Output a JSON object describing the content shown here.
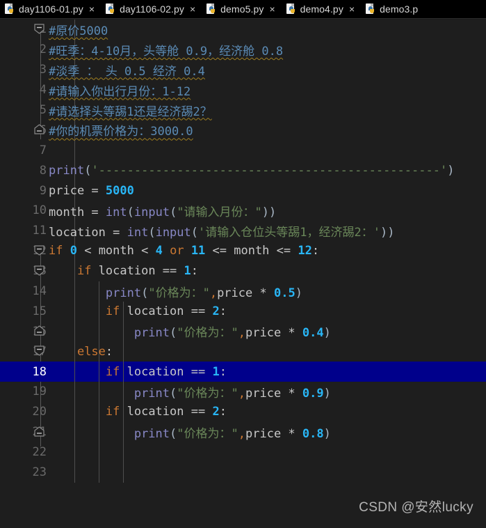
{
  "window": {
    "app": "PyCharm Editor",
    "background": "#1e1e1e"
  },
  "tabbar": {
    "background": "#000000",
    "tabs": [
      {
        "label": "day1106-01.py",
        "close": "×",
        "icon": "python-file-icon",
        "active": true
      },
      {
        "label": "day1106-02.py",
        "close": "×",
        "icon": "python-file-icon",
        "active": false
      },
      {
        "label": "demo5.py",
        "close": "×",
        "icon": "python-file-icon",
        "active": false
      },
      {
        "label": "demo4.py",
        "close": "×",
        "icon": "python-file-icon",
        "active": false
      },
      {
        "label": "demo3.p",
        "close": "",
        "icon": "python-file-icon",
        "active": false
      }
    ]
  },
  "editor": {
    "active_line": 18,
    "highlight_color": "#00008b",
    "gutter_color": "#6a6a6a",
    "colors": {
      "comment": "#5b8bb5",
      "keyword": "#cc7832",
      "number": "#29b6f6",
      "string": "#6a8759",
      "builtin": "#8888c6",
      "identifier": "#c8c8c8",
      "squiggle": "#a08020"
    },
    "line_numbers": [
      "1",
      "2",
      "3",
      "4",
      "5",
      "6",
      "7",
      "8",
      "9",
      "10",
      "11",
      "12",
      "13",
      "14",
      "15",
      "16",
      "17",
      "18",
      "19",
      "20",
      "21",
      "22",
      "23"
    ],
    "lines": {
      "l1": "#原价5000",
      "l2": "#旺季：4-10月，头等舱 0.9，经济舱 0.8",
      "l3": "#淡季 ： 头 0.5 经济 0.4",
      "l4": "#请输入你出行月份：1-12",
      "l5": "#请选择头等舓1还是经济舓2？",
      "l6": "#你的机票价格为：3000.0",
      "l7": "",
      "l8_fn": "print",
      "l8_str": "'------------------------------------------------'",
      "l9_name": "price",
      "l9_eq": " = ",
      "l9_num": "5000",
      "l10_name": "month",
      "l10_eq": " = ",
      "l10_int": "int",
      "l10_input": "input",
      "l10_str": "\"请输入月份：\"",
      "l11_name": "location",
      "l11_eq": " = ",
      "l11_int": "int",
      "l11_input": "input",
      "l11_str": "'请输入仓位头等舓1，经济舓2：'",
      "l12_if": "if",
      "l12_a": "0",
      "l12_op1": " < month < ",
      "l12_b": "4",
      "l12_or": "or",
      "l12_c": "11",
      "l12_op2": " <= month <= ",
      "l12_d": "12",
      "l13_if": "if",
      "l13_name": " location == ",
      "l13_num": "1",
      "l14_fn": "print",
      "l14_str": "\"价格为：\"",
      "l14_name": "price",
      "l14_op": " * ",
      "l14_num": "0.5",
      "l15_if": "if",
      "l15_name": " location == ",
      "l15_num": "2",
      "l16_fn": "print",
      "l16_str": "\"价格为：\"",
      "l16_name": "price",
      "l16_op": " * ",
      "l16_num": "0.4",
      "l17_else": "else",
      "l18_if": "if",
      "l18_name": " location == ",
      "l18_num": "1",
      "l19_fn": "print",
      "l19_str": "\"价格为：\"",
      "l19_name": "price",
      "l19_op": " * ",
      "l19_num": "0.9",
      "l20_if": "if",
      "l20_name": " location == ",
      "l20_num": "2",
      "l21_fn": "print",
      "l21_str": "\"价格为：\"",
      "l21_name": "price",
      "l21_op": " * ",
      "l21_num": "0.8",
      "l22": "",
      "l23": ""
    }
  },
  "watermark": {
    "text": "CSDN @安然lucky"
  }
}
